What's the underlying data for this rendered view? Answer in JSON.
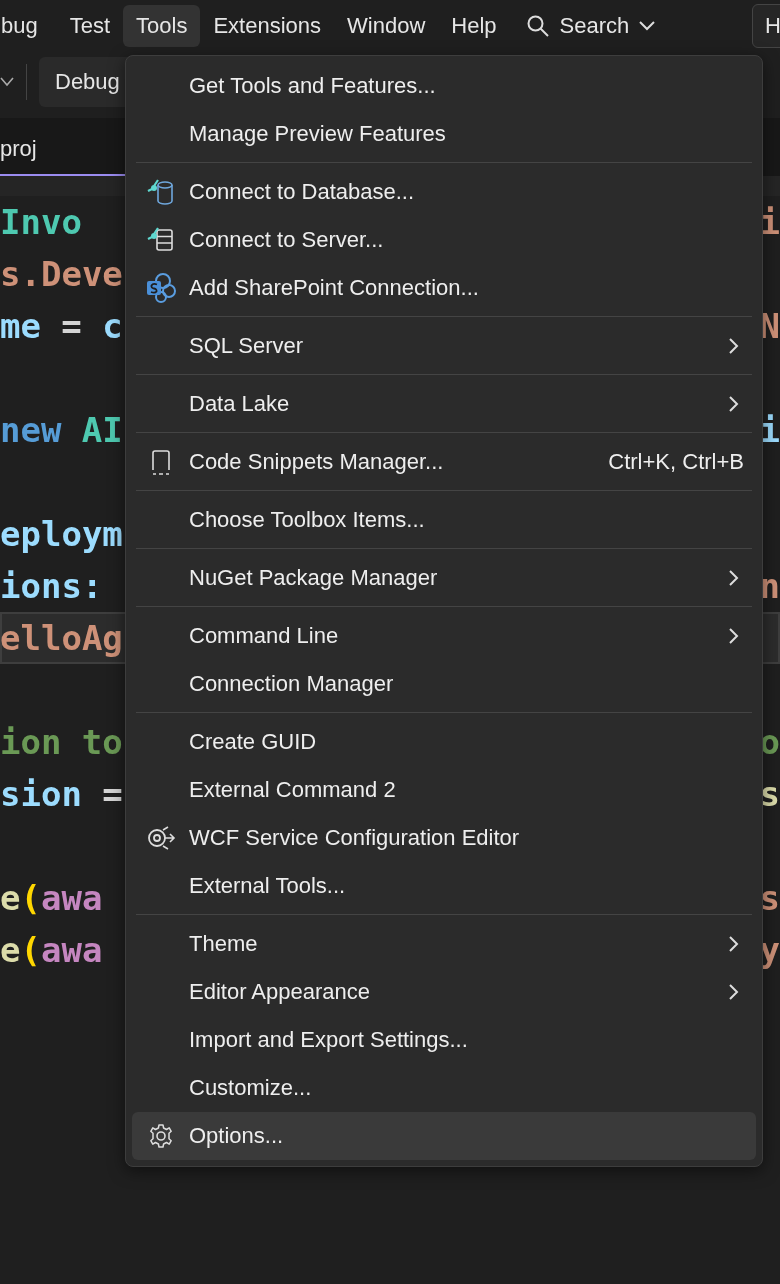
{
  "menubar": {
    "items": [
      {
        "label": "bug",
        "selected": false
      },
      {
        "label": "Test",
        "selected": false
      },
      {
        "label": "Tools",
        "selected": true
      },
      {
        "label": "Extensions",
        "selected": false
      },
      {
        "label": "Window",
        "selected": false
      },
      {
        "label": "Help",
        "selected": false
      }
    ],
    "search": {
      "label": "Search"
    },
    "edge_button": "H"
  },
  "toolbar": {
    "config": "Debug"
  },
  "tab": {
    "label": "proj"
  },
  "code_lines": [
    {
      "left": [
        {
          "t": "Invo",
          "color": "#4ec9b0"
        }
      ],
      "right": [
        {
          "t": "i",
          "color": "#ce9178"
        }
      ],
      "highlight": false
    },
    {
      "left": [
        {
          "t": "s.Deve",
          "color": "#ce9178"
        }
      ],
      "highlight": false
    },
    {
      "left": [
        {
          "t": "me",
          "color": "#9cdcfe"
        },
        {
          "t": "=",
          "color": "#d4d4d4"
        },
        {
          "t": "c",
          "color": "#9cdcfe"
        }
      ],
      "right": [
        {
          "t": "N",
          "color": "#ce9178"
        }
      ],
      "highlight": false
    },
    {
      "highlight": false
    },
    {
      "left": [
        {
          "t": "new",
          "color": "#569cd6"
        },
        {
          "t": "AI",
          "color": "#4ec9b0"
        }
      ],
      "right": [
        {
          "t": "i",
          "color": "#9cdcfe"
        }
      ],
      "highlight": false
    },
    {
      "highlight": false
    },
    {
      "left": [
        {
          "t": "eploym",
          "color": "#9cdcfe"
        }
      ],
      "highlight": false
    },
    {
      "left": [
        {
          "t": "ions:",
          "color": "#9cdcfe"
        }
      ],
      "right": [
        {
          "t": "n",
          "color": "#ce9178"
        }
      ],
      "highlight": false
    },
    {
      "left": [
        {
          "t": "elloAg",
          "color": "#ce9178"
        }
      ],
      "highlight": true
    },
    {
      "highlight": false
    },
    {
      "left": [
        {
          "t": "ion",
          "color": "#6a9955"
        },
        {
          "t": "to",
          "color": "#6a9955"
        }
      ],
      "right": [
        {
          "t": "o",
          "color": "#6a9955"
        }
      ],
      "highlight": false
    },
    {
      "left": [
        {
          "t": "sion",
          "color": "#9cdcfe"
        },
        {
          "t": "=",
          "color": "#d4d4d4"
        }
      ],
      "right": [
        {
          "t": "s",
          "color": "#dcdcaa"
        }
      ],
      "highlight": false
    },
    {
      "highlight": false
    },
    {
      "left": [
        {
          "t": "e",
          "color": "#dcdcaa"
        },
        {
          "t": "(",
          "color": "#ffd700"
        },
        {
          "t": "awa",
          "color": "#c586c0"
        }
      ],
      "right": [
        {
          "t": "s",
          "color": "#ce9178"
        }
      ],
      "highlight": false
    },
    {
      "left": [
        {
          "t": "e",
          "color": "#dcdcaa"
        },
        {
          "t": "(",
          "color": "#ffd700"
        },
        {
          "t": "awa",
          "color": "#c586c0"
        }
      ],
      "right": [
        {
          "t": "y",
          "color": "#ce9178"
        }
      ],
      "highlight": false
    }
  ],
  "menu": {
    "groups": [
      [
        {
          "label": "Get Tools and Features...",
          "selected": false
        },
        {
          "label": "Manage Preview Features",
          "selected": false
        }
      ],
      [
        {
          "label": "Connect to Database...",
          "kind": "database",
          "selected": false
        },
        {
          "label": "Connect to Server...",
          "kind": "server",
          "selected": false
        },
        {
          "label": "Add SharePoint Connection...",
          "kind": "sharepoint",
          "selected": false
        }
      ],
      [
        {
          "label": "SQL Server",
          "submenu": true,
          "selected": false
        }
      ],
      [
        {
          "label": "Data Lake",
          "submenu": true,
          "selected": false
        }
      ],
      [
        {
          "label": "Code Snippets Manager...",
          "kind": "snippet",
          "shortcut": "Ctrl+K, Ctrl+B",
          "selected": false
        }
      ],
      [
        {
          "label": "Choose Toolbox Items...",
          "selected": false
        }
      ],
      [
        {
          "label": "NuGet Package Manager",
          "submenu": true,
          "selected": false
        }
      ],
      [
        {
          "label": "Command Line",
          "submenu": true,
          "selected": false
        },
        {
          "label": "Connection Manager",
          "selected": false
        }
      ],
      [
        {
          "label": "Create GUID",
          "selected": false
        },
        {
          "label": "External Command 2",
          "selected": false
        },
        {
          "label": "WCF Service Configuration Editor",
          "kind": "service",
          "selected": false
        },
        {
          "label": "External Tools...",
          "selected": false
        }
      ],
      [
        {
          "label": "Theme",
          "submenu": true,
          "selected": false
        },
        {
          "label": "Editor Appearance",
          "submenu": true,
          "selected": false
        },
        {
          "label": "Import and Export Settings...",
          "selected": false
        },
        {
          "label": "Customize...",
          "selected": false
        },
        {
          "label": "Options...",
          "kind": "settings",
          "selected": true
        }
      ]
    ]
  }
}
